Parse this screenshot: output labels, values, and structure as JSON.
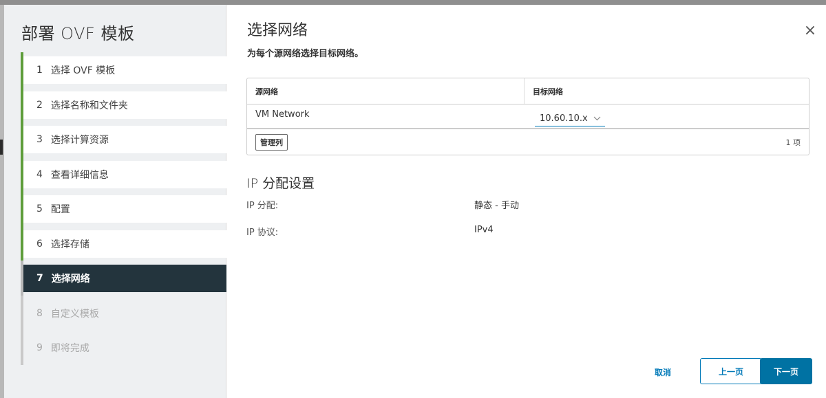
{
  "wizard": {
    "title": "部署 OVF 模板",
    "steps": [
      {
        "num": "1",
        "label": "选择 OVF 模板",
        "state": "completed"
      },
      {
        "num": "2",
        "label": "选择名称和文件夹",
        "state": "completed"
      },
      {
        "num": "3",
        "label": "选择计算资源",
        "state": "completed"
      },
      {
        "num": "4",
        "label": "查看详细信息",
        "state": "completed"
      },
      {
        "num": "5",
        "label": "配置",
        "state": "completed"
      },
      {
        "num": "6",
        "label": "选择存储",
        "state": "completed"
      },
      {
        "num": "7",
        "label": "选择网络",
        "state": "active"
      },
      {
        "num": "8",
        "label": "自定义模板",
        "state": "future"
      },
      {
        "num": "9",
        "label": "即将完成",
        "state": "future"
      }
    ]
  },
  "page": {
    "title": "选择网络",
    "subtitle": "为每个源网络选择目标网络。",
    "close_icon": "×"
  },
  "network_grid": {
    "columns": {
      "source": "源网络",
      "target": "目标网络"
    },
    "rows": [
      {
        "source": "VM Network",
        "target": "10.60.10.x"
      }
    ],
    "manage_columns_label": "管理列",
    "item_count": "1 项",
    "dropdown_icon": "chevron-down"
  },
  "ip_settings": {
    "title": "IP 分配设置",
    "allocation_label": "IP 分配:",
    "allocation_value": "静态 - 手动",
    "protocol_label": "IP 协议:",
    "protocol_value": "IPv4"
  },
  "footer": {
    "cancel_label": "取消",
    "back_label": "上一页",
    "next_label": "下一页"
  },
  "colors": {
    "accent": "#0079b8",
    "primary_button": "#0072a3",
    "active_step_bg": "#23343d",
    "completed_step_bar": "#5e9d3b"
  }
}
